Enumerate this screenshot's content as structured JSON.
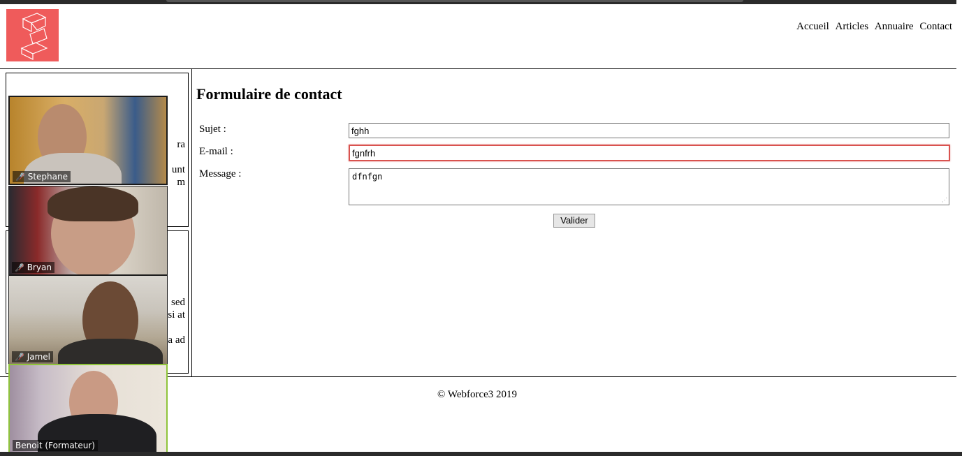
{
  "header": {
    "nav": [
      "Accueil",
      "Articles",
      "Annuaire",
      "Contact"
    ]
  },
  "sidebar": {
    "box1_fragments": [
      "ra",
      "unt",
      "m"
    ],
    "box2_fragments": [
      "sed",
      "si at",
      "a ad"
    ]
  },
  "form": {
    "title": "Formulaire de contact",
    "subject_label": "Sujet :",
    "subject_value": "fghh",
    "email_label": "E-mail :",
    "email_value": "fgnfrh",
    "message_label": "Message :",
    "message_value": "dfnfgn",
    "submit_label": "Valider"
  },
  "footer": {
    "text": "© Webforce3 2019"
  },
  "video": {
    "participants": [
      "Stephane",
      "Bryan",
      "Jamel",
      "Benoit (Formateur)"
    ]
  },
  "colors": {
    "logo": "#ef5b5b",
    "error_border": "#d9534f",
    "active_speaker_border": "#8fc43a"
  }
}
